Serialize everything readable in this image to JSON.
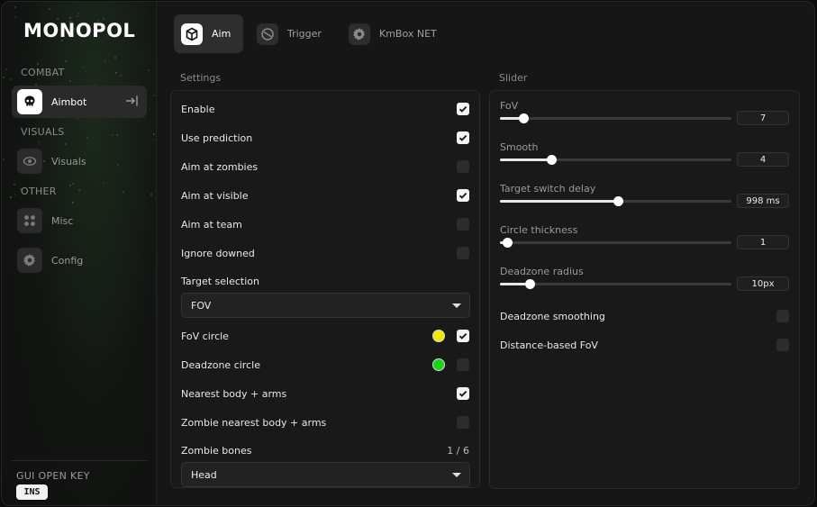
{
  "app": {
    "logo": "MONOPOL"
  },
  "sidebar": {
    "sections": [
      "COMBAT",
      "VISUALS",
      "OTHER"
    ],
    "items": [
      {
        "label": "Aimbot",
        "icon": "skull-icon",
        "active": true
      },
      {
        "label": "Visuals",
        "icon": "eye-icon",
        "active": false
      },
      {
        "label": "Misc",
        "icon": "grid-icon",
        "active": false
      },
      {
        "label": "Config",
        "icon": "gear-icon",
        "active": false
      }
    ],
    "gui_open_key_label": "GUI OPEN KEY",
    "gui_open_key_value": "INS"
  },
  "tabs": [
    {
      "label": "Aim",
      "icon": "cube-icon",
      "active": true
    },
    {
      "label": "Trigger",
      "icon": "target-icon",
      "active": false
    },
    {
      "label": "KmBox NET",
      "icon": "gear-icon",
      "active": false
    }
  ],
  "settings": {
    "title": "Settings",
    "toggles": [
      {
        "label": "Enable",
        "checked": true
      },
      {
        "label": "Use prediction",
        "checked": true
      },
      {
        "label": "Aim at zombies",
        "checked": false
      },
      {
        "label": "Aim at visible",
        "checked": true
      },
      {
        "label": "Aim at team",
        "checked": false
      },
      {
        "label": "Ignore downed",
        "checked": false
      }
    ],
    "target_selection_label": "Target selection",
    "target_selection_value": "FOV",
    "toggles2": [
      {
        "label": "FoV circle",
        "checked": true,
        "color": "#f4e800"
      },
      {
        "label": "Deadzone circle",
        "checked": false,
        "color": "#19d419"
      },
      {
        "label": "Nearest body + arms",
        "checked": true
      },
      {
        "label": "Zombie nearest body + arms",
        "checked": false
      }
    ],
    "zombie_bones_label": "Zombie bones",
    "zombie_bones_count": "1 / 6",
    "zombie_bones_value": "Head"
  },
  "slider_panel": {
    "title": "Slider",
    "sliders": [
      {
        "label": "FoV",
        "value": "7",
        "fraction": 0.1
      },
      {
        "label": "Smooth",
        "value": "4",
        "fraction": 0.22
      },
      {
        "label": "Target switch delay",
        "value": "998 ms",
        "fraction": 0.51
      },
      {
        "label": "Circle thickness",
        "value": "1",
        "fraction": 0.03
      },
      {
        "label": "Deadzone radius",
        "value": "10px",
        "fraction": 0.13
      }
    ],
    "toggles": [
      {
        "label": "Deadzone smoothing",
        "checked": false
      },
      {
        "label": "Distance-based FoV",
        "checked": false
      }
    ]
  }
}
